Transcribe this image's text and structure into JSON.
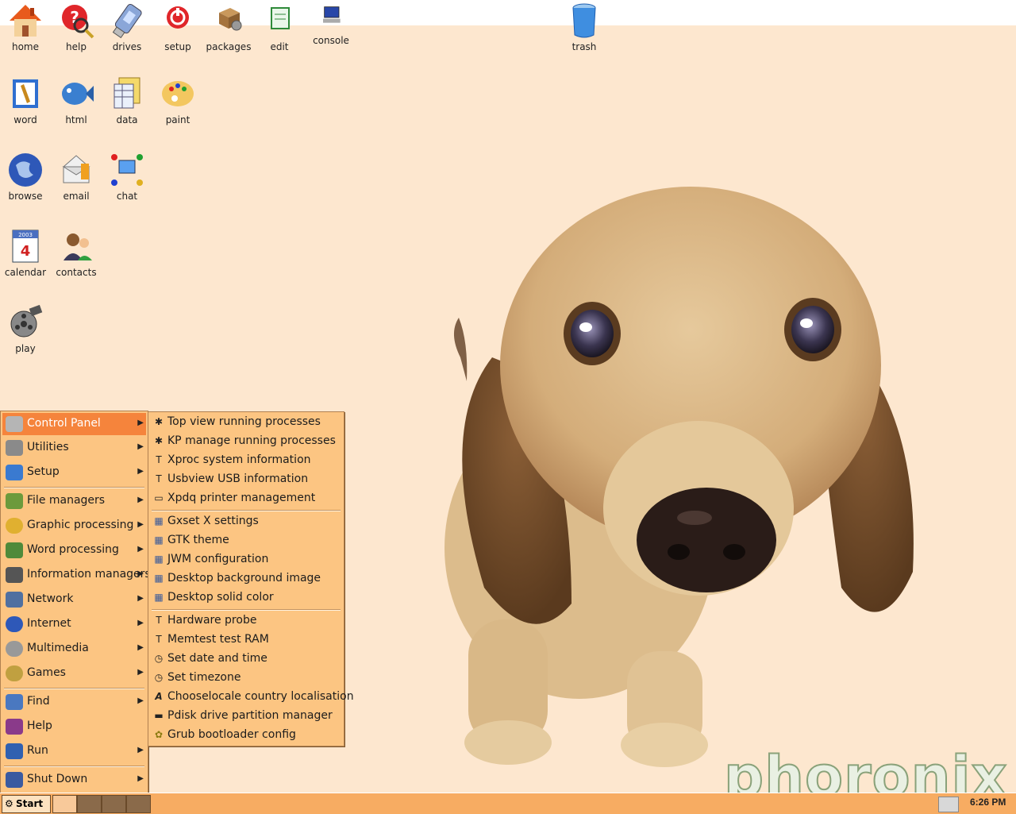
{
  "desktop": {
    "icons": [
      {
        "label": "home"
      },
      {
        "label": "help"
      },
      {
        "label": "drives"
      },
      {
        "label": "setup"
      },
      {
        "label": "packages"
      },
      {
        "label": "edit"
      },
      {
        "label": "console"
      },
      {
        "label": "trash"
      },
      {
        "label": "word"
      },
      {
        "label": "html"
      },
      {
        "label": "data"
      },
      {
        "label": "paint"
      },
      {
        "label": "browse"
      },
      {
        "label": "email"
      },
      {
        "label": "chat"
      },
      {
        "label": "calendar"
      },
      {
        "label": "contacts"
      },
      {
        "label": "play"
      }
    ],
    "watermark": "phoronix",
    "calendar_icon": {
      "year": "2003",
      "day": "4"
    }
  },
  "start_menu": {
    "items": [
      {
        "label": "Control Panel",
        "icon": "control-panel-icon",
        "active": true
      },
      {
        "label": "Utilities",
        "icon": "utilities-icon"
      },
      {
        "label": "Setup",
        "icon": "setup-icon"
      },
      {
        "label": "File managers",
        "icon": "file-managers-icon"
      },
      {
        "label": "Graphic processing",
        "icon": "graphic-processing-icon"
      },
      {
        "label": "Word processing",
        "icon": "word-processing-icon"
      },
      {
        "label": "Information managers",
        "icon": "information-managers-icon"
      },
      {
        "label": "Network",
        "icon": "network-icon"
      },
      {
        "label": "Internet",
        "icon": "internet-icon"
      },
      {
        "label": "Multimedia",
        "icon": "multimedia-icon"
      },
      {
        "label": "Games",
        "icon": "games-icon"
      },
      {
        "label": "Find",
        "icon": "find-icon"
      },
      {
        "label": "Help",
        "icon": "help-book-icon"
      },
      {
        "label": "Run",
        "icon": "run-icon"
      },
      {
        "label": "Shut Down",
        "icon": "shutdown-icon"
      }
    ]
  },
  "control_panel_menu": {
    "items": [
      {
        "label": "Top view running processes",
        "icon": "runner-icon"
      },
      {
        "label": "KP manage running processes",
        "icon": "runner-icon"
      },
      {
        "label": "Xproc system information",
        "icon": "hammer-icon"
      },
      {
        "label": "Usbview USB information",
        "icon": "hammer-icon"
      },
      {
        "label": "Xpdq printer management",
        "icon": "printer-icon"
      },
      {
        "label": "Gxset X settings",
        "icon": "settings-panel-icon"
      },
      {
        "label": "GTK theme",
        "icon": "settings-panel-icon"
      },
      {
        "label": "JWM configuration",
        "icon": "settings-panel-icon"
      },
      {
        "label": "Desktop background image",
        "icon": "settings-panel-icon"
      },
      {
        "label": "Desktop solid color",
        "icon": "settings-panel-icon"
      },
      {
        "label": "Hardware probe",
        "icon": "hammer-icon"
      },
      {
        "label": "Memtest test RAM",
        "icon": "hammer-icon"
      },
      {
        "label": "Set date and time",
        "icon": "clock-icon"
      },
      {
        "label": "Set timezone",
        "icon": "clock-icon"
      },
      {
        "label": "Chooselocale country localisation",
        "icon": "font-a-icon"
      },
      {
        "label": "Pdisk drive partition manager",
        "icon": "disk-drive-icon"
      },
      {
        "label": "Grub bootloader config",
        "icon": "grub-icon"
      }
    ]
  },
  "taskbar": {
    "start_label": "Start",
    "clock": "6:26 PM"
  },
  "colors": {
    "desktop_bg": "#fde7cf",
    "menu_bg": "#fcc582",
    "menu_active": "#f5843c",
    "taskbar_bg": "#f7ac62"
  }
}
